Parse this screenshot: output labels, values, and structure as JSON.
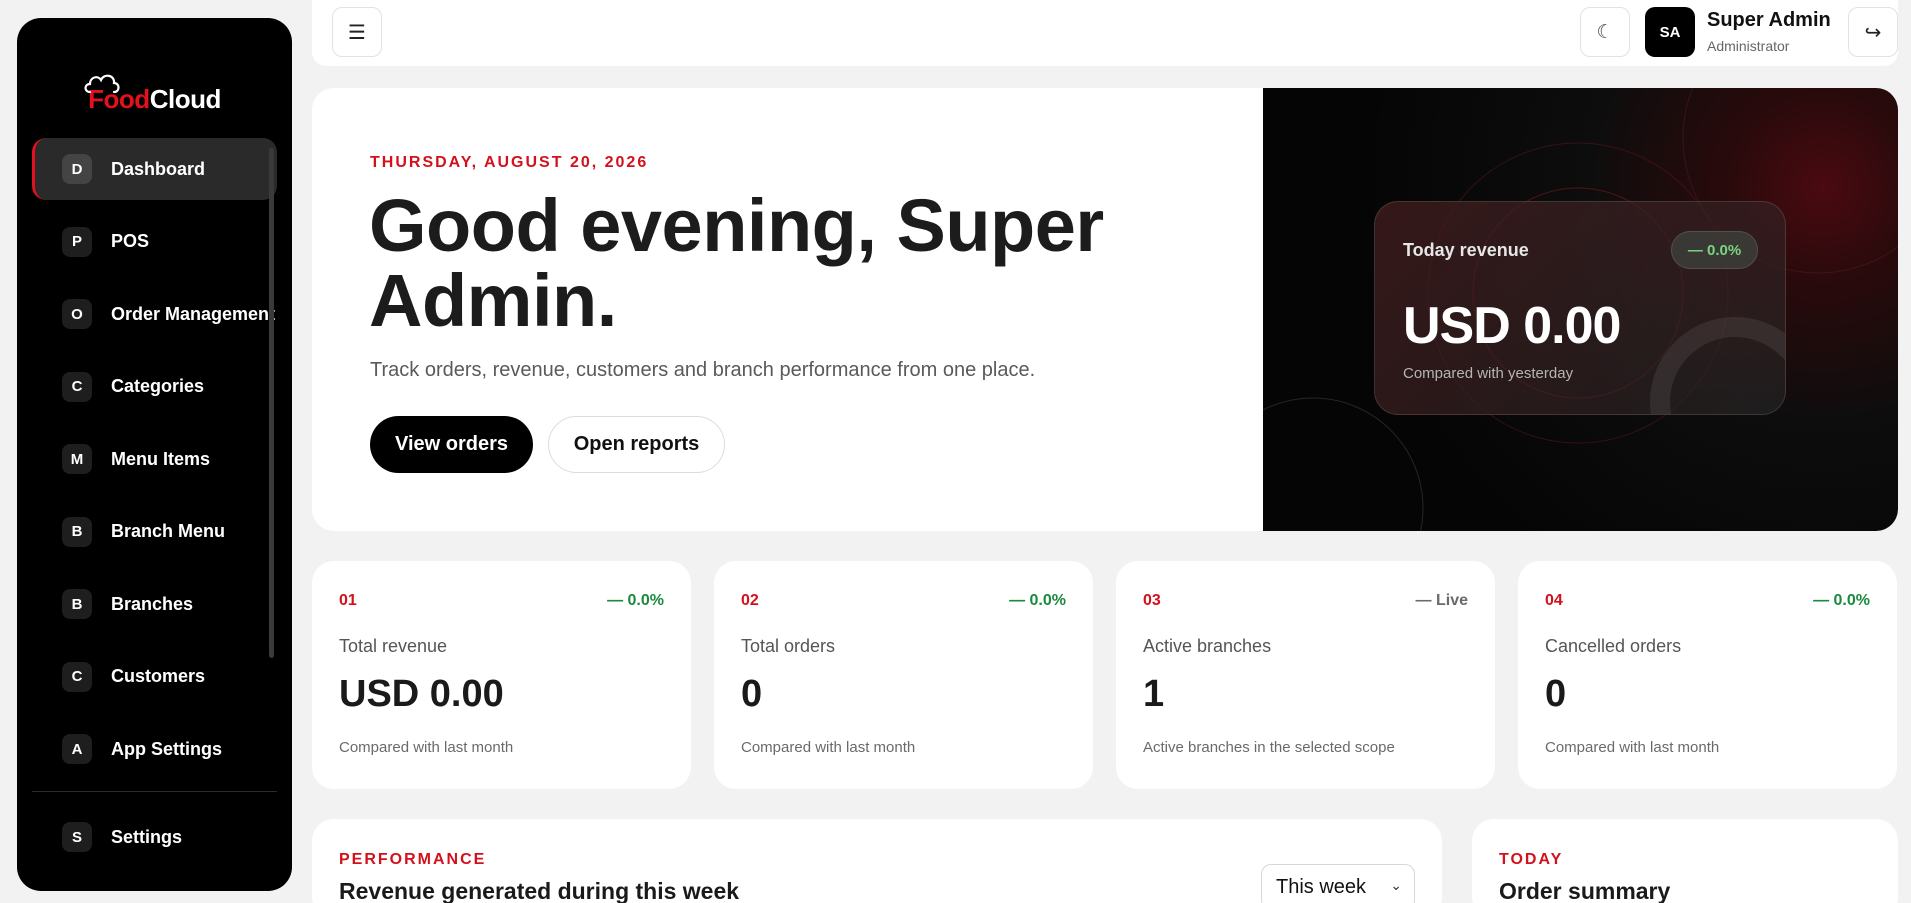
{
  "brand": {
    "food": "Food",
    "cloud": "Cloud"
  },
  "sidebar": {
    "items": [
      {
        "badge": "D",
        "label": "Dashboard",
        "active": true
      },
      {
        "badge": "P",
        "label": "POS"
      },
      {
        "badge": "O",
        "label": "Order Management"
      },
      {
        "badge": "C",
        "label": "Categories"
      },
      {
        "badge": "M",
        "label": "Menu Items"
      },
      {
        "badge": "B",
        "label": "Branch Menu"
      },
      {
        "badge": "B",
        "label": "Branches"
      },
      {
        "badge": "C",
        "label": "Customers"
      },
      {
        "badge": "A",
        "label": "App Settings"
      }
    ],
    "settings": {
      "badge": "S",
      "label": "Settings"
    }
  },
  "topbar": {
    "menu_icon": "☰",
    "theme_icon": "☾",
    "user": {
      "initials": "SA",
      "name": "Super Admin",
      "role": "Administrator"
    },
    "logout_icon": "↪"
  },
  "hero": {
    "date": "THURSDAY, AUGUST 20, 2026",
    "title": "Good evening, Super Admin.",
    "subtitle": "Track orders, revenue, customers and branch performance from one place.",
    "primary_button": "View orders",
    "secondary_button": "Open reports",
    "revenue_card": {
      "label": "Today revenue",
      "trend": "— 0.0%",
      "value": "USD 0.00",
      "note": "Compared with yesterday"
    }
  },
  "stats": [
    {
      "num": "01",
      "trend": "— 0.0%",
      "label": "Total revenue",
      "value": "USD 0.00",
      "note": "Compared with last month"
    },
    {
      "num": "02",
      "trend": "— 0.0%",
      "label": "Total orders",
      "value": "0",
      "note": "Compared with last month"
    },
    {
      "num": "03",
      "trend": "— Live",
      "label": "Active branches",
      "value": "1",
      "note": "Active branches in the selected scope"
    },
    {
      "num": "04",
      "trend": "— 0.0%",
      "label": "Cancelled orders",
      "value": "0",
      "note": "Compared with last month"
    }
  ],
  "performance": {
    "kicker": "PERFORMANCE",
    "title": "Revenue generated during this week",
    "select_value": "This week"
  },
  "today": {
    "kicker": "TODAY",
    "title": "Order summary"
  },
  "colors": {
    "accent": "#e3101d",
    "positive": "#1a8a3c",
    "sidebar_bg": "#000000"
  }
}
